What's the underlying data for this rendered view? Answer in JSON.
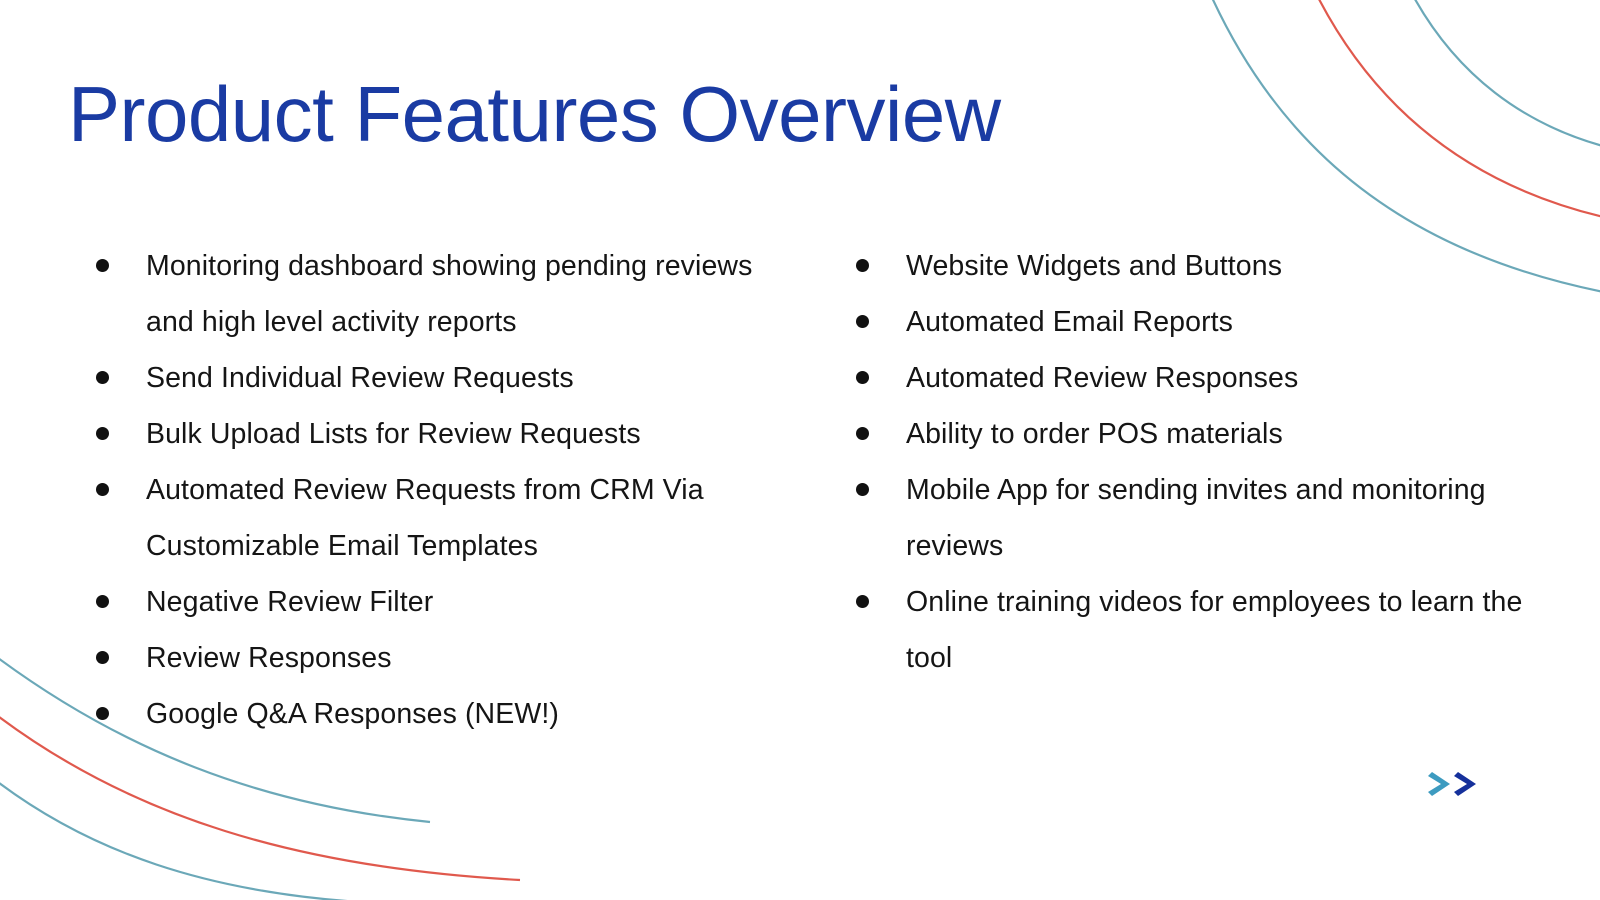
{
  "slide": {
    "title": "Product Features Overview",
    "title_color": "#1A3BA3",
    "background_color": "#FFFFFF",
    "body_text_color": "#151515"
  },
  "columns": {
    "left": {
      "bullets": [
        "Monitoring dashboard showing pending reviews and high level activity reports",
        "Send Individual Review Requests",
        "Bulk Upload Lists for Review Requests",
        "Automated Review Requests from CRM Via Customizable Email Templates",
        "Negative Review Filter",
        "Review Responses",
        "Google Q&A Responses (NEW!)"
      ]
    },
    "right": {
      "bullets": [
        "Website Widgets and Buttons",
        "Automated Email Reports",
        "Automated Review Responses",
        "Ability to order POS materials",
        "Mobile App for sending invites and monitoring reviews",
        "Online training videos for employees to learn the tool"
      ]
    }
  },
  "decorations": {
    "top_right": {
      "name": "concentric-arcs-top-right",
      "stroke_colors": [
        "#6BA8B8",
        "#E0594D",
        "#6BA8B8"
      ]
    },
    "bottom_left": {
      "name": "sweeping-curves-bottom-left",
      "stroke_colors": [
        "#6BA8B8",
        "#E0594D",
        "#6BA8B8"
      ]
    },
    "chevron_mark": {
      "name": "double-chevron-right",
      "colors": [
        "#3D9BC0",
        "#15309B"
      ]
    }
  }
}
